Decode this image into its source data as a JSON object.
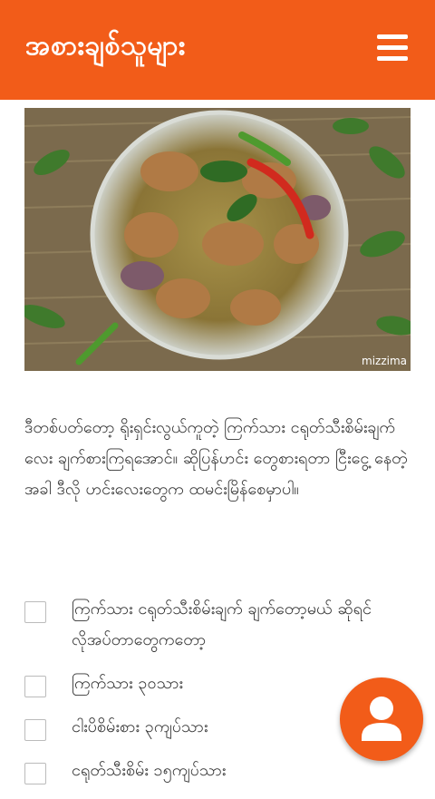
{
  "appbar": {
    "title": "အစားချစ်သူများ",
    "menu_icon": "hamburger-menu-icon"
  },
  "hero": {
    "credit": "mizzima"
  },
  "description": "ဒီတစ်ပတ်တော့ ရိုးရှင်းလွယ်ကူတဲ့ ကြက်သား ငရုတ်သီးစိမ်းချက် လေး ချက်စားကြရအောင်။ ဆိုပြန်ဟင်း တွေစားရတာ ငြီးငွေ့ နေတဲ့အခါ ဒီလို ဟင်းလေးတွေက ထမင်းမြိန်စေမှာပါ။",
  "ingredients": [
    "ကြက်သား ငရုတ်သီးစိမ်းချက် ချက်တော့မယ် ဆိုရင် လိုအပ်တာတွေကတော့",
    "ကြက်သား ၃၀သား",
    "ငါးပိစိမ်းစား ၃ကျပ်သား",
    "ငရုတ်သီးစိမ်း ၁၅ကျပ်သား"
  ],
  "fab": {
    "icon": "user-profile-icon"
  },
  "colors": {
    "accent": "#f25c19"
  }
}
